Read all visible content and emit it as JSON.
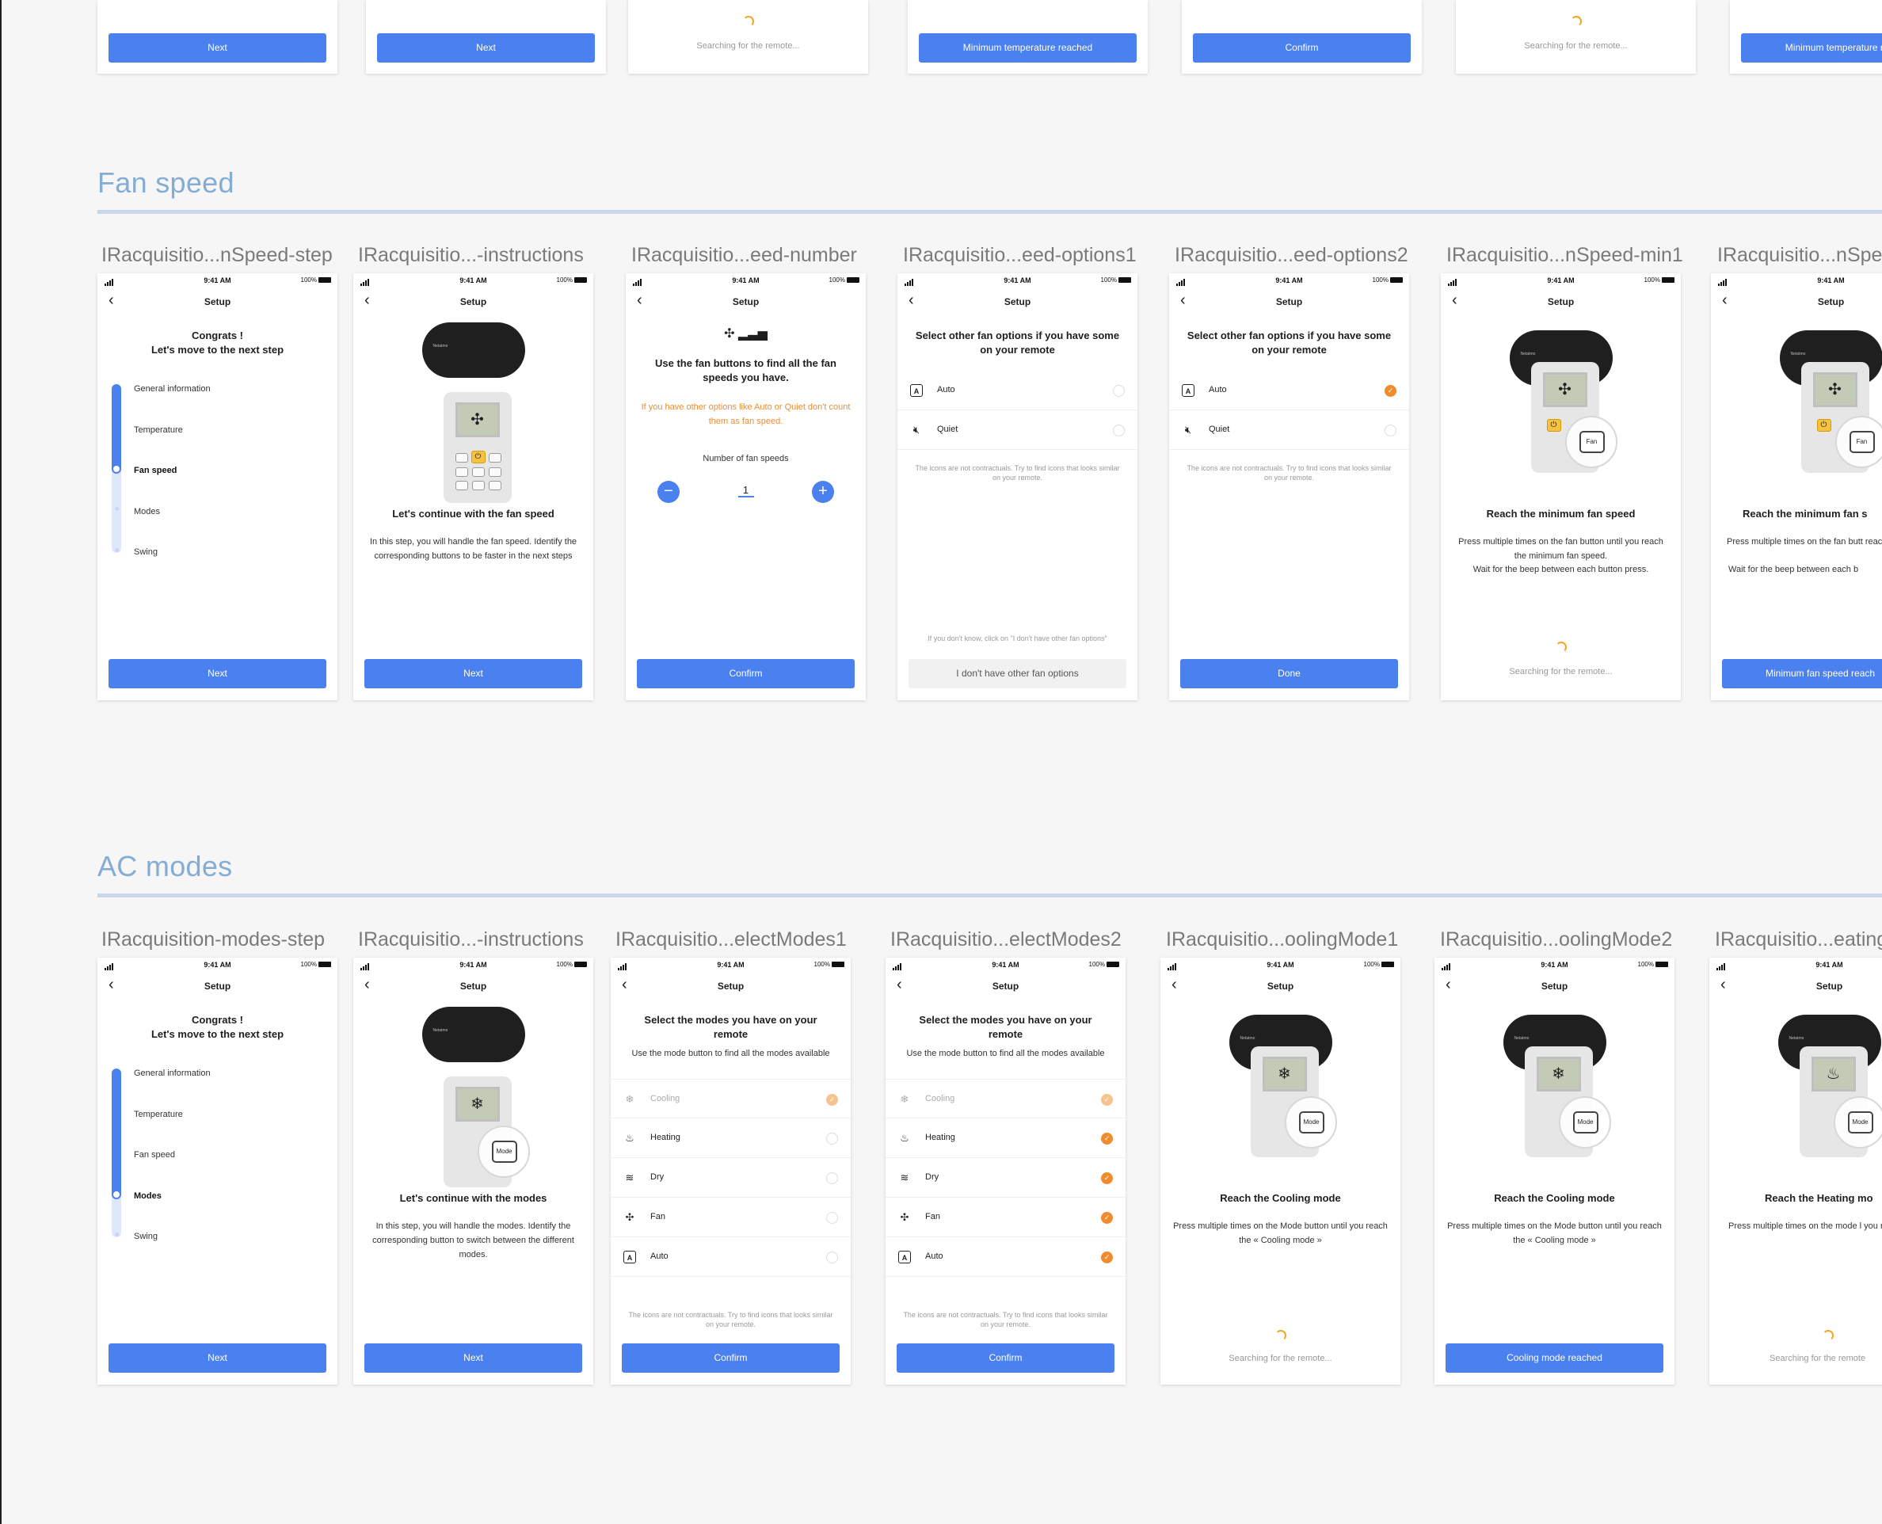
{
  "status": {
    "time": "9:41 AM",
    "battery": "100%"
  },
  "top_row": [
    {
      "type": "button",
      "label": "Next"
    },
    {
      "type": "button",
      "label": "Next"
    },
    {
      "type": "search",
      "label": "Searching for the remote..."
    },
    {
      "type": "button",
      "label": "Minimum temperature reached"
    },
    {
      "type": "button",
      "label": "Confirm"
    },
    {
      "type": "search",
      "label": "Searching for the remote..."
    },
    {
      "type": "button",
      "label": "Minimum temperature reached"
    }
  ],
  "fan": {
    "section_title": "Fan speed",
    "labels": [
      "IRacquisitio...nSpeed-step",
      "IRacquisitio...-instructions",
      "IRacquisitio...eed-number",
      "IRacquisitio...eed-options1",
      "IRacquisitio...eed-options2",
      "IRacquisitio...nSpeed-min1",
      "IRacquisitio...nSpe"
    ],
    "header": "Setup",
    "step": {
      "title": "Congrats !\nLet's move to the next step",
      "items": [
        "General information",
        "Temperature",
        "Fan speed",
        "Modes",
        "Swing"
      ],
      "button": "Next"
    },
    "instructions": {
      "title": "Let's continue with the fan speed",
      "body": "In this step, you will handle the fan speed. Identify the corresponding buttons to be faster in the next steps",
      "button": "Next"
    },
    "number": {
      "title": "Use the fan buttons to find all the fan speeds you have.",
      "warning": "If you have other options like Auto or Quiet don't count them as fan speed.",
      "counter_label": "Number of fan speeds",
      "value": "1",
      "button": "Confirm"
    },
    "options1": {
      "title": "Select other fan options if you have some on your remote",
      "options": [
        "Auto",
        "Quiet"
      ],
      "note": "The icons are not contractuals. Try to find icons that looks similar on your remote.",
      "hint": "If you don't know, click on \"I don't have other fan options\"",
      "button": "I don't have other fan options"
    },
    "options2": {
      "title": "Select other fan options if you have some on your remote",
      "options": [
        "Auto",
        "Quiet"
      ],
      "note": "The icons are not contractuals. Try to find icons that looks similar on your remote.",
      "button": "Done"
    },
    "min1": {
      "title": "Reach the minimum fan speed",
      "body": "Press multiple times on the fan button until you reach the minimum fan speed.",
      "body2": "Wait for the beep between each button press.",
      "searching": "Searching for the remote...",
      "lens": "Fan"
    },
    "min2": {
      "title": "Reach the minimum fan s",
      "body": "Press multiple times on the fan butt reach the minimum fan spe",
      "body2": "Wait for the beep between each b",
      "button": "Minimum fan speed reach",
      "lens": "Fan"
    }
  },
  "modes": {
    "section_title": "AC modes",
    "labels": [
      "IRacquisition-modes-step",
      "IRacquisitio...-instructions",
      "IRacquisitio...electModes1",
      "IRacquisitio...electModes2",
      "IRacquisitio...oolingMode1",
      "IRacquisitio...oolingMode2",
      "IRacquisitio...eating"
    ],
    "step": {
      "title": "Congrats !\nLet's move to the next step",
      "items": [
        "General information",
        "Temperature",
        "Fan speed",
        "Modes",
        "Swing"
      ],
      "button": "Next"
    },
    "instructions": {
      "title": "Let's continue with the modes",
      "body": "In this step, you will handle the modes. Identify the corresponding button to switch between the different modes.",
      "button": "Next",
      "lens": "Mode"
    },
    "select1": {
      "title": "Select the modes you have on your remote",
      "sub": "Use the mode button to find all the modes available",
      "options": [
        "Cooling",
        "Heating",
        "Dry",
        "Fan",
        "Auto"
      ],
      "note": "The icons are not contractuals. Try to find icons that looks similar on your remote.",
      "button": "Confirm"
    },
    "select2": {
      "title": "Select the modes you have on your remote",
      "sub": "Use the mode button to find all the modes available",
      "options": [
        "Cooling",
        "Heating",
        "Dry",
        "Fan",
        "Auto"
      ],
      "note": "The icons are not contractuals. Try to find icons that looks similar on your remote.",
      "button": "Confirm"
    },
    "cooling1": {
      "title": "Reach the Cooling mode",
      "body": "Press multiple times on the Mode button until you reach the « Cooling mode »",
      "searching": "Searching for the remote...",
      "lens": "Mode"
    },
    "cooling2": {
      "title": "Reach the Cooling mode",
      "body": "Press multiple times on the Mode button until you reach the « Cooling mode »",
      "button": "Cooling mode reached",
      "lens": "Mode"
    },
    "heating": {
      "title": "Reach the Heating mo",
      "body": "Press multiple times on the mode l you reach the « Heating mo",
      "searching": "Searching for the remote",
      "lens": "Mode"
    }
  },
  "remote_brand": "Netatmo",
  "colors": {
    "primary": "#4b80ef",
    "accent": "#f08c2e",
    "section": "#86acd4"
  }
}
